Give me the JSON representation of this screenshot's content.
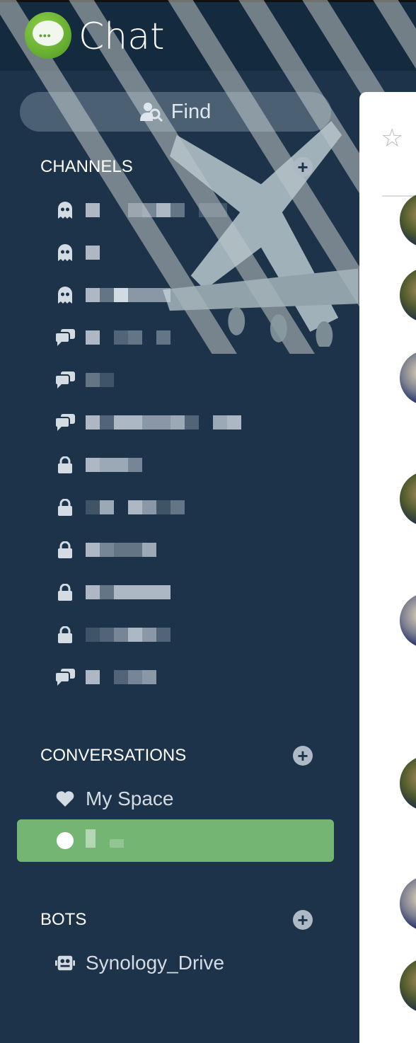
{
  "app": {
    "title": "Chat"
  },
  "search": {
    "label": "Find"
  },
  "sections": {
    "channels": {
      "title": "CHANNELS",
      "items": [
        {
          "type": "ghost"
        },
        {
          "type": "ghost"
        },
        {
          "type": "ghost"
        },
        {
          "type": "chat"
        },
        {
          "type": "chat"
        },
        {
          "type": "chat"
        },
        {
          "type": "lock"
        },
        {
          "type": "lock"
        },
        {
          "type": "lock"
        },
        {
          "type": "lock"
        },
        {
          "type": "lock"
        },
        {
          "type": "chat"
        }
      ]
    },
    "conversations": {
      "title": "CONVERSATIONS",
      "items": [
        {
          "label": "My Space",
          "icon": "heart-icon"
        },
        {
          "label": "",
          "icon": "status-dot-icon",
          "selected": true
        }
      ]
    },
    "bots": {
      "title": "BOTS",
      "items": [
        {
          "label": "Synology_Drive",
          "icon": "robot-icon"
        }
      ]
    }
  },
  "colors": {
    "sidebar": "#1c3349",
    "header": "#142a3f",
    "selected": "#74b573",
    "accent": "#5aa52a"
  }
}
